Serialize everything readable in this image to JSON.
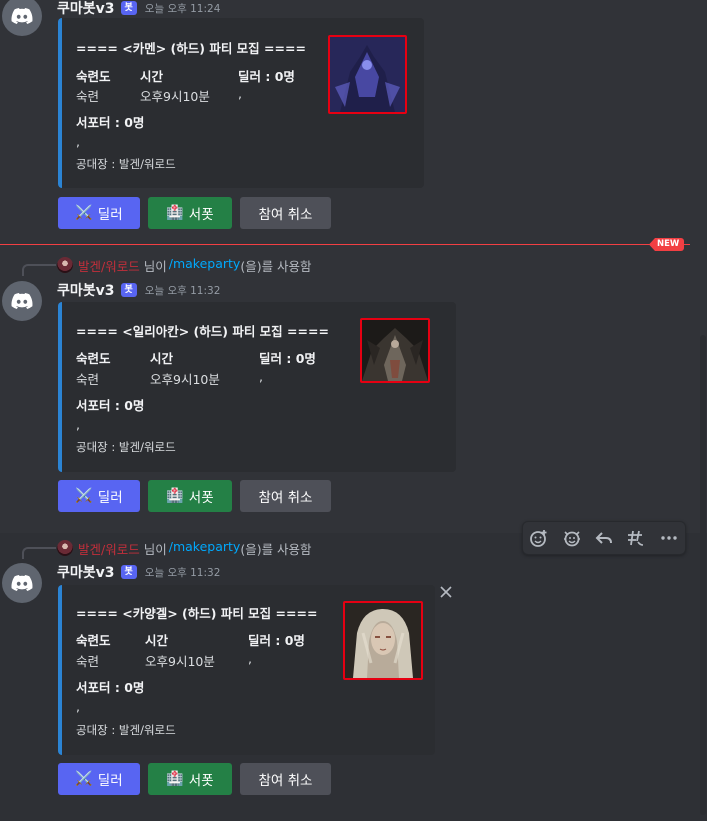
{
  "bot_name": "쿠마봇v3",
  "bot_tag": "봇",
  "new_label": "NEW",
  "reply": {
    "user": "발겐/워로드",
    "mid": "님이",
    "command": "/makeparty",
    "suffix": "(을)를 사용함"
  },
  "field_labels": {
    "proficiency": "숙련도",
    "time": "시간",
    "dealer": "딜러 : 0명",
    "supporter": "서포터 : 0명"
  },
  "buttons": {
    "dealer": "딜러",
    "support": "서폿",
    "cancel": "참여 취소"
  },
  "messages": [
    {
      "timestamp": "오늘 오후 11:24",
      "title": "==== <카멘> (하드) 파티 모집 ====",
      "proficiency": "숙련",
      "time": "오후9시10분",
      "dealer_list": ",",
      "supporter_list": ",",
      "leader": "공대장 : 발겐/워로드",
      "thumb_icon": "kamen-boss-image"
    },
    {
      "timestamp": "오늘 오후 11:32",
      "title": "==== <일리아칸> (하드) 파티 모집 ====",
      "proficiency": "숙련",
      "time": "오후9시10분",
      "dealer_list": ",",
      "supporter_list": ",",
      "leader": "공대장 : 발겐/워로드",
      "thumb_icon": "illiakan-boss-image"
    },
    {
      "timestamp": "오늘 오후 11:32",
      "title": "==== <카양겔> (하드) 파티 모집 ====",
      "proficiency": "숙련",
      "time": "오후9시10분",
      "dealer_list": ",",
      "supporter_list": ",",
      "leader": "공대장 : 발겐/워로드",
      "thumb_icon": "kayangel-boss-image"
    }
  ],
  "colors": {
    "blurple": "#5865f2",
    "green": "#248046",
    "gray": "#4e5058",
    "embed_bar": "#2b84d4",
    "highlight": "#e60012",
    "new_red": "#f23f43"
  }
}
